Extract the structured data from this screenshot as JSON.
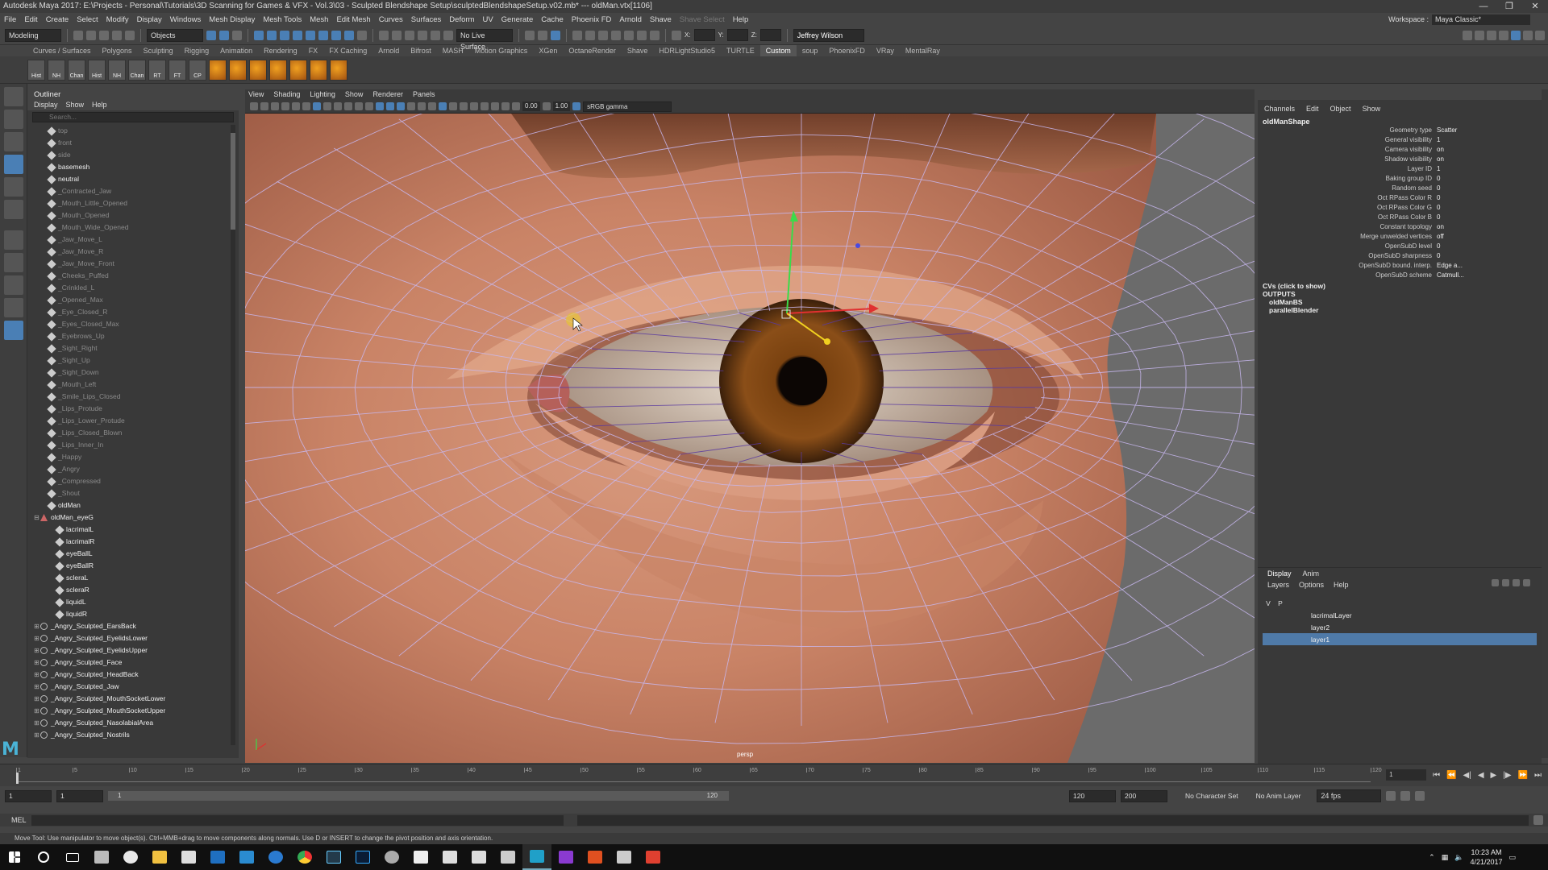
{
  "window": {
    "title": "Autodesk Maya 2017: E:\\Projects - Personal\\Tutorials\\3D Scanning for Games & VFX - Vol.3\\03 - Sculpted Blendshape Setup\\sculptedBlendshapeSetup.v02.mb*   ---   oldMan.vtx[1106]"
  },
  "menubar": {
    "items": [
      "File",
      "Edit",
      "Create",
      "Select",
      "Modify",
      "Display",
      "Windows",
      "Mesh Display",
      "Mesh Tools",
      "Mesh",
      "Edit Mesh",
      "Curves",
      "Surfaces",
      "Deform",
      "UV",
      "Generate",
      "Cache",
      "Phoenix FD",
      "Arnold",
      "Shave"
    ],
    "disabled_item": "Shave Select",
    "help": "Help",
    "workspace_label": "Workspace :",
    "workspace_value": "Maya Classic*"
  },
  "statusline": {
    "mode": "Modeling",
    "objects": "Objects",
    "live_surface": "No Live Surface",
    "x_label": "X:",
    "y_label": "Y:",
    "z_label": "Z:",
    "user": "Jeffrey Wilson"
  },
  "shelf": {
    "tabs": [
      "Curves / Surfaces",
      "Polygons",
      "Sculpting",
      "Rigging",
      "Animation",
      "Rendering",
      "FX",
      "FX Caching",
      "Arnold",
      "Bifrost",
      "MASH",
      "Motion Graphics",
      "XGen",
      "OctaneRender",
      "Shave",
      "HDRLightStudio5",
      "TURTLE",
      "Custom",
      "soup",
      "PhoenixFD",
      "VRay",
      "MentalRay"
    ],
    "active_tab": "Custom",
    "icons": [
      "Hist",
      "NH",
      "Chan",
      "Hist",
      "NH",
      "Chan",
      "RT",
      "FT",
      "CP"
    ]
  },
  "outliner": {
    "title": "Outliner",
    "menu": [
      "Display",
      "Show",
      "Help"
    ],
    "search_placeholder": "Search...",
    "items": [
      {
        "label": "top",
        "type": "cam",
        "hidden": true,
        "indent": 1
      },
      {
        "label": "front",
        "type": "cam",
        "hidden": true,
        "indent": 1
      },
      {
        "label": "side",
        "type": "cam",
        "hidden": true,
        "indent": 1
      },
      {
        "label": "basemesh",
        "type": "geo",
        "hidden": false,
        "indent": 1
      },
      {
        "label": "neutral",
        "type": "geo",
        "hidden": false,
        "indent": 1
      },
      {
        "label": "_Contracted_Jaw",
        "type": "geo",
        "hidden": true,
        "indent": 1
      },
      {
        "label": "_Mouth_Little_Opened",
        "type": "geo",
        "hidden": true,
        "indent": 1
      },
      {
        "label": "_Mouth_Opened",
        "type": "geo",
        "hidden": true,
        "indent": 1
      },
      {
        "label": "_Mouth_Wide_Opened",
        "type": "geo",
        "hidden": true,
        "indent": 1
      },
      {
        "label": "_Jaw_Move_L",
        "type": "geo",
        "hidden": true,
        "indent": 1
      },
      {
        "label": "_Jaw_Move_R",
        "type": "geo",
        "hidden": true,
        "indent": 1
      },
      {
        "label": "_Jaw_Move_Front",
        "type": "geo",
        "hidden": true,
        "indent": 1
      },
      {
        "label": "_Cheeks_Puffed",
        "type": "geo",
        "hidden": true,
        "indent": 1
      },
      {
        "label": "_Crinkled_L",
        "type": "geo",
        "hidden": true,
        "indent": 1
      },
      {
        "label": "_Opened_Max",
        "type": "geo",
        "hidden": true,
        "indent": 1
      },
      {
        "label": "_Eye_Closed_R",
        "type": "geo",
        "hidden": true,
        "indent": 1
      },
      {
        "label": "_Eyes_Closed_Max",
        "type": "geo",
        "hidden": true,
        "indent": 1
      },
      {
        "label": "_Eyebrows_Up",
        "type": "geo",
        "hidden": true,
        "indent": 1
      },
      {
        "label": "_Sight_Right",
        "type": "geo",
        "hidden": true,
        "indent": 1
      },
      {
        "label": "_Sight_Up",
        "type": "geo",
        "hidden": true,
        "indent": 1
      },
      {
        "label": "_Sight_Down",
        "type": "geo",
        "hidden": true,
        "indent": 1
      },
      {
        "label": "_Mouth_Left",
        "type": "geo",
        "hidden": true,
        "indent": 1
      },
      {
        "label": "_Smile_Lips_Closed",
        "type": "geo",
        "hidden": true,
        "indent": 1
      },
      {
        "label": "_Lips_Protude",
        "type": "geo",
        "hidden": true,
        "indent": 1
      },
      {
        "label": "_Lips_Lower_Protude",
        "type": "geo",
        "hidden": true,
        "indent": 1
      },
      {
        "label": "_Lips_Closed_Blown",
        "type": "geo",
        "hidden": true,
        "indent": 1
      },
      {
        "label": "_Lips_Inner_In",
        "type": "geo",
        "hidden": true,
        "indent": 1
      },
      {
        "label": "_Happy",
        "type": "geo",
        "hidden": true,
        "indent": 1
      },
      {
        "label": "_Angry",
        "type": "geo",
        "hidden": true,
        "indent": 1
      },
      {
        "label": "_Compressed",
        "type": "geo",
        "hidden": true,
        "indent": 1
      },
      {
        "label": "_Shout",
        "type": "geo",
        "hidden": true,
        "indent": 1
      },
      {
        "label": "oldMan",
        "type": "geo",
        "hidden": false,
        "indent": 1
      },
      {
        "label": "oldMan_eyeG",
        "type": "grp",
        "hidden": false,
        "indent": 0,
        "expand": "⊟"
      },
      {
        "label": "lacrimalL",
        "type": "geo",
        "hidden": false,
        "indent": 2
      },
      {
        "label": "lacrimalR",
        "type": "geo",
        "hidden": false,
        "indent": 2
      },
      {
        "label": "eyeBallL",
        "type": "geo",
        "hidden": false,
        "indent": 2
      },
      {
        "label": "eyeBallR",
        "type": "geo",
        "hidden": false,
        "indent": 2
      },
      {
        "label": "scleraL",
        "type": "geo",
        "hidden": false,
        "indent": 2
      },
      {
        "label": "scleraR",
        "type": "geo",
        "hidden": false,
        "indent": 2
      },
      {
        "label": "liquidL",
        "type": "geo",
        "hidden": false,
        "indent": 2
      },
      {
        "label": "liquidR",
        "type": "geo",
        "hidden": false,
        "indent": 2
      },
      {
        "label": "_Angry_Sculpted_EarsBack",
        "type": "bs",
        "hidden": false,
        "indent": 0,
        "expand": "⊞"
      },
      {
        "label": "_Angry_Sculpted_EyelidsLower",
        "type": "bs",
        "hidden": false,
        "indent": 0,
        "expand": "⊞"
      },
      {
        "label": "_Angry_Sculpted_EyelidsUpper",
        "type": "bs",
        "hidden": false,
        "indent": 0,
        "expand": "⊞"
      },
      {
        "label": "_Angry_Sculpted_Face",
        "type": "bs",
        "hidden": false,
        "indent": 0,
        "expand": "⊞"
      },
      {
        "label": "_Angry_Sculpted_HeadBack",
        "type": "bs",
        "hidden": false,
        "indent": 0,
        "expand": "⊞"
      },
      {
        "label": "_Angry_Sculpted_Jaw",
        "type": "bs",
        "hidden": false,
        "indent": 0,
        "expand": "⊞"
      },
      {
        "label": "_Angry_Sculpted_MouthSocketLower",
        "type": "bs",
        "hidden": false,
        "indent": 0,
        "expand": "⊞"
      },
      {
        "label": "_Angry_Sculpted_MouthSocketUpper",
        "type": "bs",
        "hidden": false,
        "indent": 0,
        "expand": "⊞"
      },
      {
        "label": "_Angry_Sculpted_NasolabialArea",
        "type": "bs",
        "hidden": false,
        "indent": 0,
        "expand": "⊞"
      },
      {
        "label": "_Angry_Sculpted_Nostrils",
        "type": "bs",
        "hidden": false,
        "indent": 0,
        "expand": "⊞"
      }
    ]
  },
  "viewport": {
    "menu": [
      "View",
      "Shading",
      "Lighting",
      "Show",
      "Renderer",
      "Panels"
    ],
    "exposure": "0.00",
    "gamma": "1.00",
    "color_space": "sRGB gamma",
    "camera_label": "persp"
  },
  "channelbox": {
    "menu": [
      "Channels",
      "Edit",
      "Object",
      "Show"
    ],
    "object": "oldManShape",
    "attributes": [
      {
        "name": "Geometry type",
        "value": "Scatter"
      },
      {
        "name": "General visibility",
        "value": "1"
      },
      {
        "name": "Camera visibility",
        "value": "on"
      },
      {
        "name": "Shadow visibility",
        "value": "on"
      },
      {
        "name": "Layer ID",
        "value": "1"
      },
      {
        "name": "Baking group ID",
        "value": "0"
      },
      {
        "name": "Random seed",
        "value": "0"
      },
      {
        "name": "Oct RPass Color R",
        "value": "0"
      },
      {
        "name": "Oct RPass Color G",
        "value": "0"
      },
      {
        "name": "Oct RPass Color B",
        "value": "0"
      },
      {
        "name": "Constant topology",
        "value": "on"
      },
      {
        "name": "Merge unwelded vertices",
        "value": "off"
      },
      {
        "name": "OpenSubD level",
        "value": "0"
      },
      {
        "name": "OpenSubD sharpness",
        "value": "0"
      },
      {
        "name": "OpenSubD bound. interp.",
        "value": "Edge a..."
      },
      {
        "name": "OpenSubD scheme",
        "value": "Catmull..."
      }
    ],
    "cvs": "CVs (click to show)",
    "outputs_label": "OUTPUTS",
    "outputs": [
      "oldManBS",
      "parallelBlender"
    ]
  },
  "layers": {
    "tabs": [
      "Display",
      "Anim"
    ],
    "menu": [
      "Layers",
      "Options",
      "Help"
    ],
    "header_v": "V",
    "header_p": "P",
    "rows": [
      {
        "name": "lacrimalLayer",
        "selected": false
      },
      {
        "name": "layer2",
        "selected": false
      },
      {
        "name": "layer1",
        "selected": true
      }
    ]
  },
  "timeline": {
    "ticks": [
      "1",
      "5",
      "10",
      "15",
      "20",
      "25",
      "30",
      "35",
      "40",
      "45",
      "50",
      "55",
      "60",
      "65",
      "70",
      "75",
      "80",
      "85",
      "90",
      "95",
      "100",
      "105",
      "110",
      "115",
      "120"
    ],
    "current_frame": "1"
  },
  "range": {
    "start": "1",
    "start2": "1",
    "inner_start": "1",
    "inner_end": "120",
    "end": "120",
    "end2": "200",
    "character_set": "No Character Set",
    "anim_layer": "No Anim Layer",
    "fps": "24 fps"
  },
  "mel": {
    "label": "MEL"
  },
  "help_line": "Move Tool: Use manipulator to move object(s). Ctrl+MMB+drag to move components along normals. Use D or INSERT to change the pivot position and axis orientation.",
  "taskbar": {
    "time": "10:23 AM",
    "date": "4/21/2017"
  },
  "logo": "M"
}
